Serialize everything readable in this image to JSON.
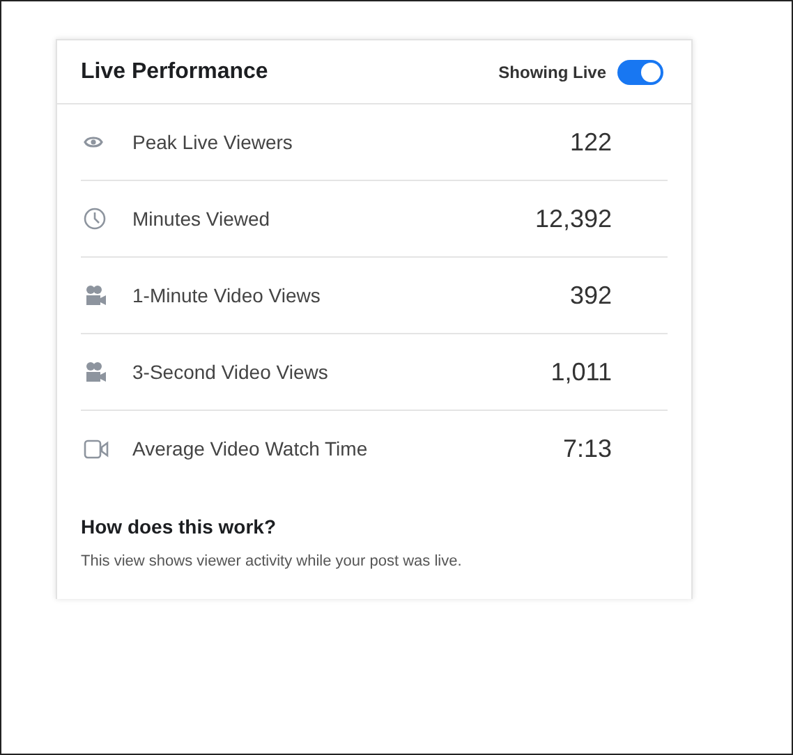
{
  "title": "Live Performance",
  "toggle": {
    "label": "Showing Live",
    "on": true
  },
  "metrics": [
    {
      "kind": "eye",
      "label": "Peak Live Viewers",
      "value": "122"
    },
    {
      "kind": "clock",
      "label": "Minutes Viewed",
      "value": "12,392"
    },
    {
      "kind": "camera",
      "label": "1-Minute Video Views",
      "value": "392"
    },
    {
      "kind": "camera",
      "label": "3-Second Video Views",
      "value": "1,011"
    },
    {
      "kind": "video",
      "label": "Average Video Watch Time",
      "value": "7:13"
    }
  ],
  "help": {
    "heading": "How does this work?",
    "text": "This view shows viewer activity while your post was live."
  }
}
